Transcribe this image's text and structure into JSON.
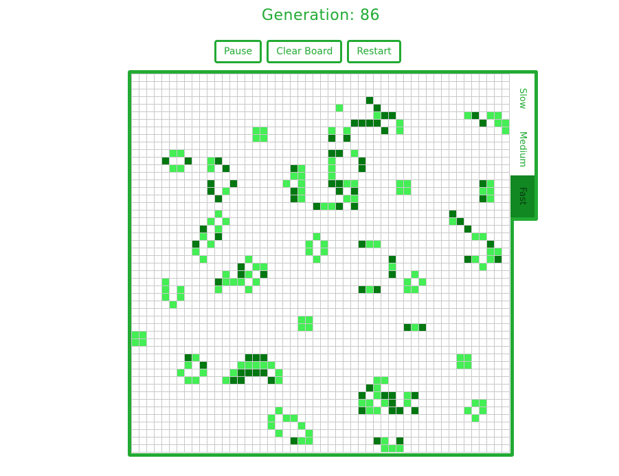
{
  "generation": {
    "label": "Generation: 86"
  },
  "controls": {
    "pause_label": "Pause",
    "clear_label": "Clear Board",
    "restart_label": "Restart"
  },
  "speed": {
    "options": [
      "Slow",
      "Medium",
      "Fast"
    ],
    "selected": "Fast"
  },
  "colors": {
    "accent": "#22aa33",
    "cell_alive": "#44ee55",
    "cell_old": "#007711",
    "grid_line": "#c8c8c8",
    "speed_active_bg": "#118822"
  },
  "board": {
    "cols": 50,
    "rows": 50,
    "cells": [
      [
        31,
        3,
        "d"
      ],
      [
        27,
        4,
        "l"
      ],
      [
        32,
        4,
        "d"
      ],
      [
        44,
        5,
        "l"
      ],
      [
        45,
        5,
        "d"
      ],
      [
        47,
        5,
        "l"
      ],
      [
        48,
        5,
        "l"
      ],
      [
        32,
        5,
        "l"
      ],
      [
        33,
        5,
        "d"
      ],
      [
        34,
        5,
        "d"
      ],
      [
        29,
        6,
        "d"
      ],
      [
        30,
        6,
        "d"
      ],
      [
        31,
        6,
        "d"
      ],
      [
        32,
        6,
        "d"
      ],
      [
        35,
        6,
        "l"
      ],
      [
        46,
        6,
        "d"
      ],
      [
        48,
        6,
        "l"
      ],
      [
        49,
        6,
        "l"
      ],
      [
        16,
        7,
        "l"
      ],
      [
        17,
        7,
        "l"
      ],
      [
        26,
        7,
        "l"
      ],
      [
        28,
        7,
        "l"
      ],
      [
        33,
        7,
        "d"
      ],
      [
        35,
        7,
        "l"
      ],
      [
        49,
        7,
        "l"
      ],
      [
        16,
        8,
        "l"
      ],
      [
        17,
        8,
        "l"
      ],
      [
        26,
        8,
        "d"
      ],
      [
        28,
        8,
        "d"
      ],
      [
        5,
        10,
        "l"
      ],
      [
        6,
        10,
        "l"
      ],
      [
        26,
        10,
        "d"
      ],
      [
        27,
        10,
        "d"
      ],
      [
        29,
        10,
        "l"
      ],
      [
        4,
        11,
        "d"
      ],
      [
        7,
        11,
        "d"
      ],
      [
        10,
        11,
        "l"
      ],
      [
        11,
        11,
        "d"
      ],
      [
        26,
        11,
        "l"
      ],
      [
        30,
        11,
        "d"
      ],
      [
        5,
        12,
        "l"
      ],
      [
        6,
        12,
        "l"
      ],
      [
        10,
        12,
        "l"
      ],
      [
        12,
        12,
        "d"
      ],
      [
        21,
        12,
        "d"
      ],
      [
        22,
        12,
        "l"
      ],
      [
        26,
        12,
        "l"
      ],
      [
        30,
        12,
        "d"
      ],
      [
        22,
        13,
        "l"
      ],
      [
        21,
        13,
        "l"
      ],
      [
        26,
        13,
        "l"
      ],
      [
        10,
        14,
        "d"
      ],
      [
        13,
        14,
        "d"
      ],
      [
        20,
        14,
        "l"
      ],
      [
        22,
        14,
        "l"
      ],
      [
        26,
        14,
        "d"
      ],
      [
        27,
        14,
        "d"
      ],
      [
        28,
        14,
        "l"
      ],
      [
        29,
        14,
        "l"
      ],
      [
        35,
        14,
        "l"
      ],
      [
        36,
        14,
        "l"
      ],
      [
        46,
        14,
        "d"
      ],
      [
        47,
        14,
        "l"
      ],
      [
        10,
        15,
        "d"
      ],
      [
        12,
        15,
        "l"
      ],
      [
        21,
        15,
        "d"
      ],
      [
        22,
        15,
        "l"
      ],
      [
        27,
        15,
        "d"
      ],
      [
        29,
        15,
        "d"
      ],
      [
        35,
        15,
        "l"
      ],
      [
        36,
        15,
        "l"
      ],
      [
        46,
        15,
        "l"
      ],
      [
        47,
        15,
        "l"
      ],
      [
        11,
        16,
        "d"
      ],
      [
        21,
        16,
        "d"
      ],
      [
        22,
        16,
        "l"
      ],
      [
        28,
        16,
        "l"
      ],
      [
        29,
        16,
        "l"
      ],
      [
        46,
        16,
        "d"
      ],
      [
        47,
        16,
        "l"
      ],
      [
        24,
        17,
        "d"
      ],
      [
        25,
        17,
        "l"
      ],
      [
        26,
        17,
        "l"
      ],
      [
        27,
        17,
        "d"
      ],
      [
        29,
        17,
        "d"
      ],
      [
        11,
        18,
        "l"
      ],
      [
        42,
        18,
        "d"
      ],
      [
        10,
        19,
        "l"
      ],
      [
        12,
        19,
        "l"
      ],
      [
        42,
        19,
        "l"
      ],
      [
        43,
        19,
        "d"
      ],
      [
        9,
        20,
        "d"
      ],
      [
        11,
        20,
        "l"
      ],
      [
        44,
        20,
        "d"
      ],
      [
        9,
        21,
        "l"
      ],
      [
        11,
        21,
        "d"
      ],
      [
        24,
        21,
        "l"
      ],
      [
        45,
        21,
        "l"
      ],
      [
        46,
        21,
        "l"
      ],
      [
        8,
        22,
        "d"
      ],
      [
        10,
        22,
        "l"
      ],
      [
        23,
        22,
        "l"
      ],
      [
        25,
        22,
        "l"
      ],
      [
        30,
        22,
        "d"
      ],
      [
        31,
        22,
        "l"
      ],
      [
        32,
        22,
        "l"
      ],
      [
        47,
        22,
        "d"
      ],
      [
        8,
        23,
        "l"
      ],
      [
        23,
        23,
        "l"
      ],
      [
        25,
        23,
        "l"
      ],
      [
        47,
        23,
        "l"
      ],
      [
        48,
        23,
        "l"
      ],
      [
        9,
        24,
        "l"
      ],
      [
        15,
        24,
        "l"
      ],
      [
        24,
        24,
        "l"
      ],
      [
        34,
        24,
        "d"
      ],
      [
        44,
        24,
        "d"
      ],
      [
        45,
        24,
        "l"
      ],
      [
        47,
        24,
        "l"
      ],
      [
        48,
        24,
        "d"
      ],
      [
        14,
        25,
        "d"
      ],
      [
        16,
        25,
        "l"
      ],
      [
        17,
        25,
        "l"
      ],
      [
        34,
        25,
        "l"
      ],
      [
        46,
        25,
        "l"
      ],
      [
        12,
        26,
        "l"
      ],
      [
        14,
        26,
        "d"
      ],
      [
        15,
        26,
        "l"
      ],
      [
        17,
        26,
        "d"
      ],
      [
        34,
        26,
        "d"
      ],
      [
        37,
        26,
        "l"
      ],
      [
        4,
        27,
        "l"
      ],
      [
        11,
        27,
        "d"
      ],
      [
        12,
        27,
        "l"
      ],
      [
        13,
        27,
        "l"
      ],
      [
        14,
        27,
        "l"
      ],
      [
        16,
        27,
        "l"
      ],
      [
        36,
        27,
        "l"
      ],
      [
        38,
        27,
        "l"
      ],
      [
        4,
        28,
        "l"
      ],
      [
        6,
        28,
        "l"
      ],
      [
        11,
        28,
        "l"
      ],
      [
        15,
        28,
        "l"
      ],
      [
        30,
        28,
        "d"
      ],
      [
        31,
        28,
        "l"
      ],
      [
        32,
        28,
        "d"
      ],
      [
        36,
        28,
        "l"
      ],
      [
        37,
        28,
        "l"
      ],
      [
        4,
        29,
        "l"
      ],
      [
        6,
        29,
        "l"
      ],
      [
        5,
        30,
        "l"
      ],
      [
        22,
        32,
        "l"
      ],
      [
        23,
        32,
        "l"
      ],
      [
        22,
        33,
        "l"
      ],
      [
        23,
        33,
        "l"
      ],
      [
        36,
        33,
        "d"
      ],
      [
        37,
        33,
        "l"
      ],
      [
        38,
        33,
        "d"
      ],
      [
        0,
        34,
        "l"
      ],
      [
        1,
        34,
        "l"
      ],
      [
        0,
        35,
        "l"
      ],
      [
        1,
        35,
        "l"
      ],
      [
        7,
        37,
        "d"
      ],
      [
        8,
        37,
        "l"
      ],
      [
        15,
        37,
        "d"
      ],
      [
        16,
        37,
        "d"
      ],
      [
        17,
        37,
        "d"
      ],
      [
        43,
        37,
        "l"
      ],
      [
        44,
        37,
        "l"
      ],
      [
        7,
        38,
        "l"
      ],
      [
        9,
        38,
        "d"
      ],
      [
        14,
        38,
        "l"
      ],
      [
        15,
        38,
        "l"
      ],
      [
        16,
        38,
        "l"
      ],
      [
        17,
        38,
        "l"
      ],
      [
        18,
        38,
        "l"
      ],
      [
        43,
        38,
        "l"
      ],
      [
        44,
        38,
        "l"
      ],
      [
        6,
        39,
        "l"
      ],
      [
        9,
        39,
        "l"
      ],
      [
        13,
        39,
        "l"
      ],
      [
        14,
        39,
        "d"
      ],
      [
        15,
        39,
        "d"
      ],
      [
        16,
        39,
        "d"
      ],
      [
        17,
        39,
        "d"
      ],
      [
        19,
        39,
        "l"
      ],
      [
        7,
        40,
        "l"
      ],
      [
        8,
        40,
        "l"
      ],
      [
        12,
        40,
        "l"
      ],
      [
        13,
        40,
        "d"
      ],
      [
        14,
        40,
        "d"
      ],
      [
        18,
        40,
        "d"
      ],
      [
        19,
        40,
        "l"
      ],
      [
        32,
        40,
        "l"
      ],
      [
        33,
        40,
        "l"
      ],
      [
        31,
        41,
        "d"
      ],
      [
        32,
        41,
        "l"
      ],
      [
        30,
        42,
        "d"
      ],
      [
        32,
        42,
        "l"
      ],
      [
        33,
        42,
        "d"
      ],
      [
        34,
        42,
        "d"
      ],
      [
        36,
        42,
        "l"
      ],
      [
        37,
        42,
        "d"
      ],
      [
        30,
        43,
        "l"
      ],
      [
        31,
        43,
        "l"
      ],
      [
        33,
        43,
        "l"
      ],
      [
        34,
        43,
        "d"
      ],
      [
        36,
        43,
        "l"
      ],
      [
        45,
        43,
        "l"
      ],
      [
        46,
        43,
        "l"
      ],
      [
        19,
        44,
        "l"
      ],
      [
        30,
        44,
        "d"
      ],
      [
        31,
        44,
        "l"
      ],
      [
        32,
        44,
        "l"
      ],
      [
        34,
        44,
        "d"
      ],
      [
        35,
        44,
        "d"
      ],
      [
        37,
        44,
        "d"
      ],
      [
        44,
        44,
        "l"
      ],
      [
        46,
        44,
        "l"
      ],
      [
        18,
        45,
        "l"
      ],
      [
        20,
        45,
        "l"
      ],
      [
        21,
        45,
        "l"
      ],
      [
        45,
        45,
        "l"
      ],
      [
        18,
        46,
        "l"
      ],
      [
        22,
        46,
        "l"
      ],
      [
        19,
        47,
        "l"
      ],
      [
        23,
        47,
        "l"
      ],
      [
        21,
        48,
        "d"
      ],
      [
        22,
        48,
        "l"
      ],
      [
        23,
        48,
        "l"
      ],
      [
        32,
        48,
        "d"
      ],
      [
        33,
        48,
        "l"
      ],
      [
        35,
        48,
        "d"
      ],
      [
        33,
        49,
        "l"
      ],
      [
        34,
        49,
        "l"
      ],
      [
        35,
        49,
        "l"
      ]
    ]
  }
}
